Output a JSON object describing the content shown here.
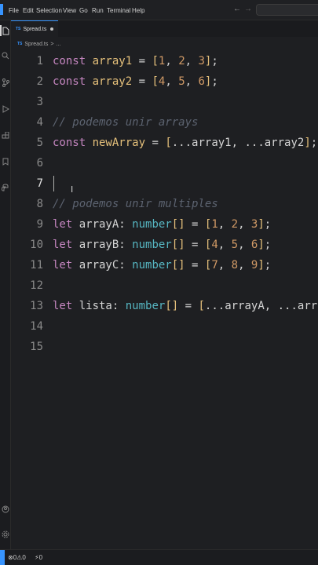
{
  "menu": [
    "File",
    "Edit",
    "Selection",
    "View",
    "Go",
    "Run",
    "Terminal",
    "Help"
  ],
  "nav": {
    "back": "←",
    "forward": "→"
  },
  "tab": {
    "label": "Spread.ts",
    "lang": "TS"
  },
  "breadcrumb": {
    "file": "Spread.ts",
    "sep": ">",
    "more": "..."
  },
  "editor": {
    "cursor_line": 7,
    "lines": [
      {
        "n": "1",
        "tokens": [
          [
            "k",
            "const "
          ],
          [
            "v",
            "array1"
          ],
          [
            "p",
            " = "
          ],
          [
            "b",
            "["
          ],
          [
            "n",
            "1"
          ],
          [
            "p",
            ", "
          ],
          [
            "n",
            "2"
          ],
          [
            "p",
            ", "
          ],
          [
            "n",
            "3"
          ],
          [
            "b",
            "]"
          ],
          [
            "p",
            ";"
          ]
        ]
      },
      {
        "n": "2",
        "tokens": [
          [
            "k",
            "const "
          ],
          [
            "v",
            "array2"
          ],
          [
            "p",
            " = "
          ],
          [
            "b",
            "["
          ],
          [
            "n",
            "4"
          ],
          [
            "p",
            ", "
          ],
          [
            "n",
            "5"
          ],
          [
            "p",
            ", "
          ],
          [
            "n",
            "6"
          ],
          [
            "b",
            "]"
          ],
          [
            "p",
            ";"
          ]
        ]
      },
      {
        "n": "3",
        "tokens": []
      },
      {
        "n": "4",
        "tokens": [
          [
            "c",
            "// podemos unir arrays"
          ]
        ]
      },
      {
        "n": "5",
        "tokens": [
          [
            "k",
            "const "
          ],
          [
            "v",
            "newArray"
          ],
          [
            "p",
            " = "
          ],
          [
            "b",
            "["
          ],
          [
            "p",
            "...array1, ...array2"
          ],
          [
            "b",
            "]"
          ],
          [
            "p",
            ";"
          ]
        ]
      },
      {
        "n": "6",
        "tokens": []
      },
      {
        "n": "7",
        "tokens": []
      },
      {
        "n": "8",
        "tokens": [
          [
            "c",
            "// podemos unir multiples"
          ]
        ]
      },
      {
        "n": "9",
        "tokens": [
          [
            "k",
            "let "
          ],
          [
            "p",
            "arrayA: "
          ],
          [
            "t",
            "number"
          ],
          [
            "b",
            "[]"
          ],
          [
            "p",
            " = "
          ],
          [
            "b",
            "["
          ],
          [
            "n",
            "1"
          ],
          [
            "p",
            ", "
          ],
          [
            "n",
            "2"
          ],
          [
            "p",
            ", "
          ],
          [
            "n",
            "3"
          ],
          [
            "b",
            "]"
          ],
          [
            "p",
            ";"
          ]
        ]
      },
      {
        "n": "10",
        "tokens": [
          [
            "k",
            "let "
          ],
          [
            "p",
            "arrayB: "
          ],
          [
            "t",
            "number"
          ],
          [
            "b",
            "[]"
          ],
          [
            "p",
            " = "
          ],
          [
            "b",
            "["
          ],
          [
            "n",
            "4"
          ],
          [
            "p",
            ", "
          ],
          [
            "n",
            "5"
          ],
          [
            "p",
            ", "
          ],
          [
            "n",
            "6"
          ],
          [
            "b",
            "]"
          ],
          [
            "p",
            ";"
          ]
        ]
      },
      {
        "n": "11",
        "tokens": [
          [
            "k",
            "let "
          ],
          [
            "p",
            "arrayC: "
          ],
          [
            "t",
            "number"
          ],
          [
            "b",
            "[]"
          ],
          [
            "p",
            " = "
          ],
          [
            "b",
            "["
          ],
          [
            "n",
            "7"
          ],
          [
            "p",
            ", "
          ],
          [
            "n",
            "8"
          ],
          [
            "p",
            ", "
          ],
          [
            "n",
            "9"
          ],
          [
            "b",
            "]"
          ],
          [
            "p",
            ";"
          ]
        ]
      },
      {
        "n": "12",
        "tokens": []
      },
      {
        "n": "13",
        "tokens": [
          [
            "k",
            "let "
          ],
          [
            "p",
            "lista: "
          ],
          [
            "t",
            "number"
          ],
          [
            "b",
            "[]"
          ],
          [
            "p",
            " = "
          ],
          [
            "b",
            "["
          ],
          [
            "p",
            "...arrayA, ...arrayB, "
          ]
        ]
      },
      {
        "n": "14",
        "tokens": []
      },
      {
        "n": "15",
        "tokens": []
      }
    ]
  },
  "activity_icons": [
    "files-icon",
    "search-icon",
    "source-control-icon",
    "run-debug-icon",
    "extensions-icon",
    "bookmark-icon",
    "python-icon"
  ],
  "activity_bottom": [
    "account-icon",
    "settings-gear-icon"
  ],
  "status": {
    "problems": "⊗0⚠0",
    "ports": "⚡0"
  },
  "colors": {
    "accent": "#3794ff",
    "keyword": "#c586c0",
    "variable": "#e5c07b",
    "number": "#d19a66",
    "type": "#56b6c2",
    "comment": "#5c6370"
  }
}
